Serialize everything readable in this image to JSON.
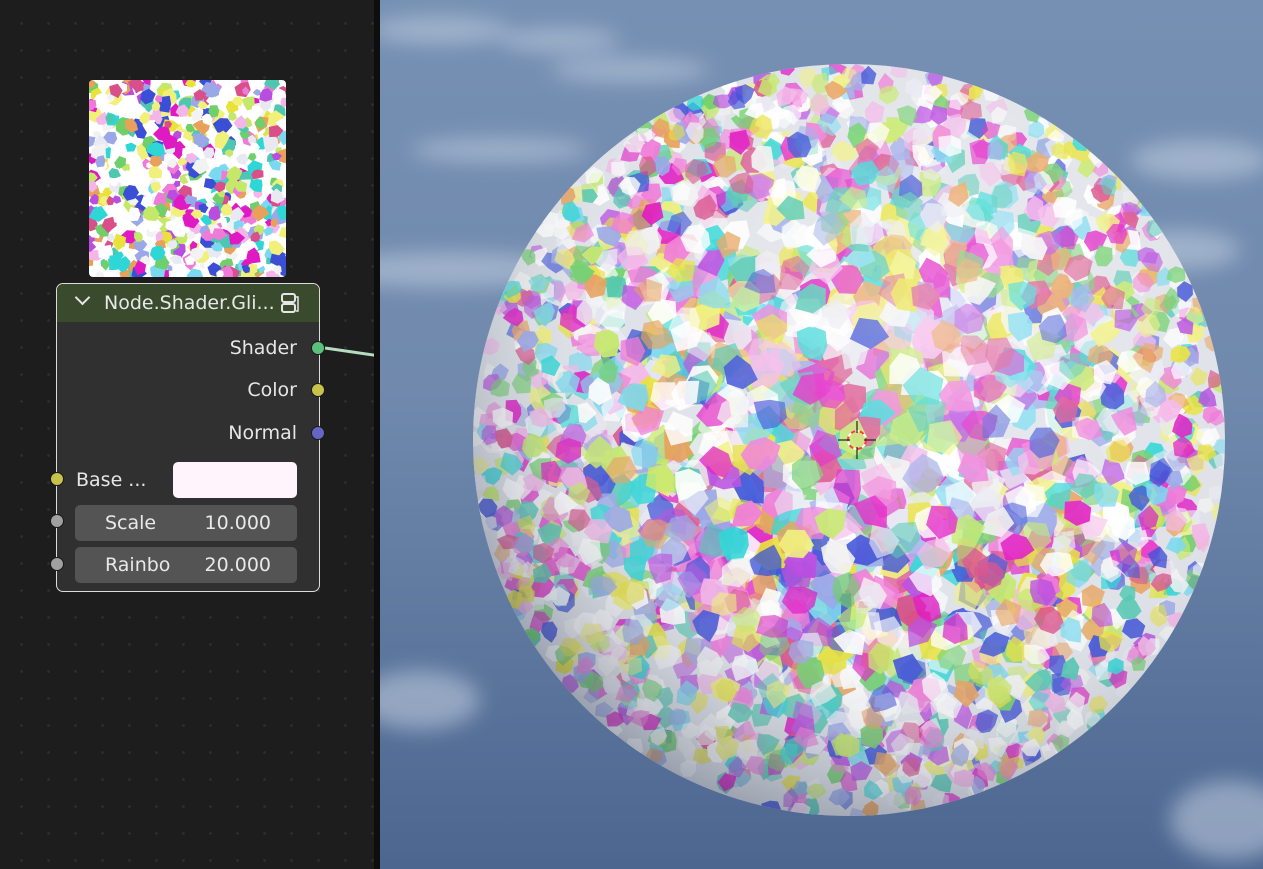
{
  "node_editor": {
    "node": {
      "title": "Node.Shader.Gli...",
      "header_color": "#3a4a2d",
      "outputs": [
        {
          "label": "Shader",
          "socket_color": "#5bc07a"
        },
        {
          "label": "Color",
          "socket_color": "#c7c24a"
        },
        {
          "label": "Normal",
          "socket_color": "#6565c4"
        }
      ],
      "inputs": {
        "base_color": {
          "label": "Base ...",
          "swatch_color": "#fff4fb",
          "socket_color": "#c7c24a"
        },
        "scale": {
          "label": "Scale",
          "value": "10.000",
          "socket_color": "#a0a0a0"
        },
        "rainbow": {
          "label": "Rainbo",
          "value": "20.000",
          "socket_color": "#a0a0a0"
        }
      },
      "icons": [
        "collapse-chevron-icon",
        "node-group-icon"
      ]
    }
  },
  "viewport": {
    "object": "glitter sphere",
    "background": "sky",
    "icons": [
      "3d-cursor-icon"
    ]
  }
}
